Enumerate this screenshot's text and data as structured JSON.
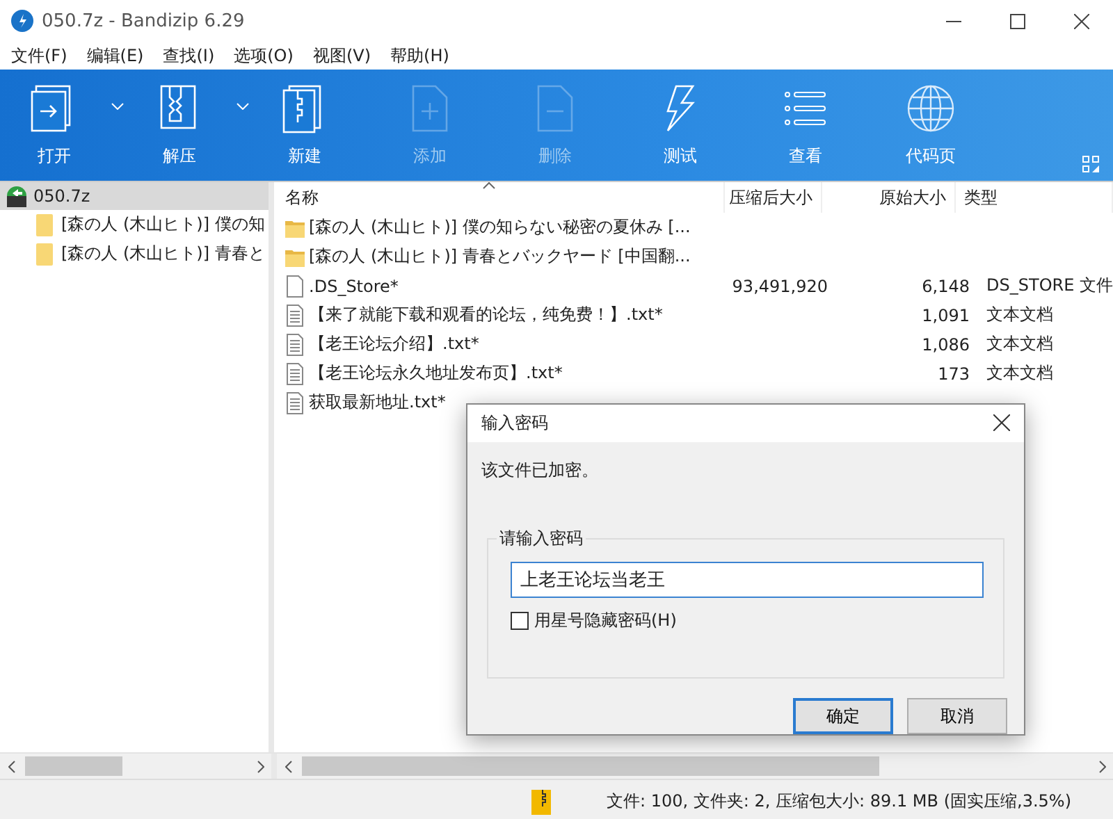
{
  "window": {
    "title": "050.7z - Bandizip 6.29"
  },
  "menu": [
    "文件(F)",
    "编辑(E)",
    "查找(I)",
    "选项(O)",
    "视图(V)",
    "帮助(H)"
  ],
  "toolbar": [
    {
      "kind": "open",
      "label": "打开",
      "dropdown": true,
      "disabled": false
    },
    {
      "kind": "extract",
      "label": "解压",
      "dropdown": true,
      "disabled": false
    },
    {
      "kind": "new",
      "label": "新建",
      "dropdown": false,
      "disabled": false
    },
    {
      "kind": "add",
      "label": "添加",
      "dropdown": false,
      "disabled": true
    },
    {
      "kind": "delete",
      "label": "删除",
      "dropdown": false,
      "disabled": true
    },
    {
      "kind": "test",
      "label": "测试",
      "dropdown": false,
      "disabled": false
    },
    {
      "kind": "view",
      "label": "查看",
      "dropdown": false,
      "disabled": false
    },
    {
      "kind": "codepage",
      "label": "代码页",
      "dropdown": false,
      "disabled": false
    }
  ],
  "sidebar": {
    "items": [
      {
        "label": "050.7z",
        "selected": true,
        "children": [
          {
            "label": "[森の人 (木山ヒト)] 僕の知",
            "selected": false
          },
          {
            "label": "[森の人 (木山ヒト)] 青春と",
            "selected": false
          }
        ]
      }
    ]
  },
  "table": {
    "columns": [
      {
        "label": "名称",
        "sorted": true
      },
      {
        "label": "压缩后大小",
        "sorted": false
      },
      {
        "label": "原始大小",
        "sorted": false
      },
      {
        "label": "类型",
        "sorted": false
      }
    ],
    "rows": [
      {
        "kind": "folder",
        "name": "[森の人 (木山ヒト)] 僕の知らない秘密の夏休み [..."
      },
      {
        "kind": "folder",
        "name": "[森の人 (木山ヒト)] 青春とバックヤード [中国翻..."
      },
      {
        "kind": "file",
        "name": ".DS_Store*",
        "packed": "93,491,920",
        "size": "6,148",
        "type": "DS_STORE 文件"
      },
      {
        "kind": "text",
        "name": "【来了就能下载和观看的论坛，纯免费！】.txt*",
        "size": "1,091",
        "type": "文本文档"
      },
      {
        "kind": "text",
        "name": "【老王论坛介绍】.txt*",
        "size": "1,086",
        "type": "文本文档"
      },
      {
        "kind": "text",
        "name": "【老王论坛永久地址发布页】.txt*",
        "size": "173",
        "type": "文本文档"
      },
      {
        "kind": "text",
        "name": "获取最新地址.txt*"
      }
    ]
  },
  "status_bar": {
    "text": "文件: 100, 文件夹: 2, 压缩包大小: 89.1 MB (固实压缩,3.5%)"
  },
  "dialog": {
    "title": "输入密码",
    "message": "该文件已加密。",
    "group": "请输入密码",
    "value": "上老王论坛当老王",
    "checkbox": {
      "label": "用星号隐藏密码(H)",
      "checked": false
    },
    "buttons": [
      {
        "label": "确定",
        "default": true
      },
      {
        "label": "取消",
        "default": false
      }
    ]
  }
}
